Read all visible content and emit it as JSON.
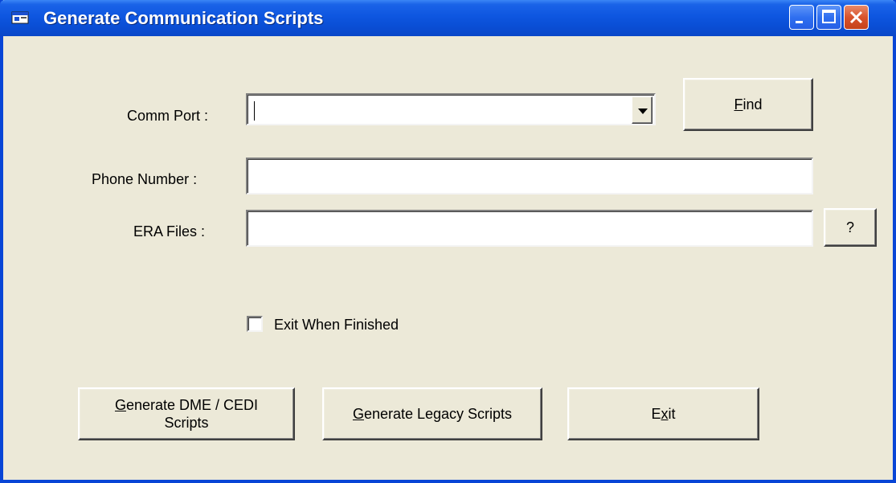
{
  "window": {
    "title": "Generate Communication Scripts",
    "controls": {
      "minimize": "minimize",
      "maximize": "maximize",
      "close": "close"
    }
  },
  "form": {
    "comm_port_label": "Comm Port :",
    "comm_port_value": "",
    "phone_number_label": "Phone Number :",
    "phone_number_value": "",
    "era_files_label": "ERA Files :",
    "era_files_value": "",
    "find_button": {
      "prefix": "",
      "accel": "F",
      "rest": "ind"
    },
    "browse_button_label": "?",
    "exit_when_finished_label": "Exit When Finished",
    "exit_when_finished_checked": false
  },
  "buttons": {
    "generate_dme": {
      "accel": "G",
      "line1_rest": "enerate DME / CEDI",
      "line2": "Scripts"
    },
    "generate_legacy": {
      "accel": "G",
      "rest": "enerate Legacy Scripts"
    },
    "exit": {
      "prefix": "E",
      "accel": "x",
      "rest": "it"
    }
  },
  "colors": {
    "face": "#ece9d8",
    "titlebar": "#0a4fd6",
    "close": "#d9532c"
  }
}
